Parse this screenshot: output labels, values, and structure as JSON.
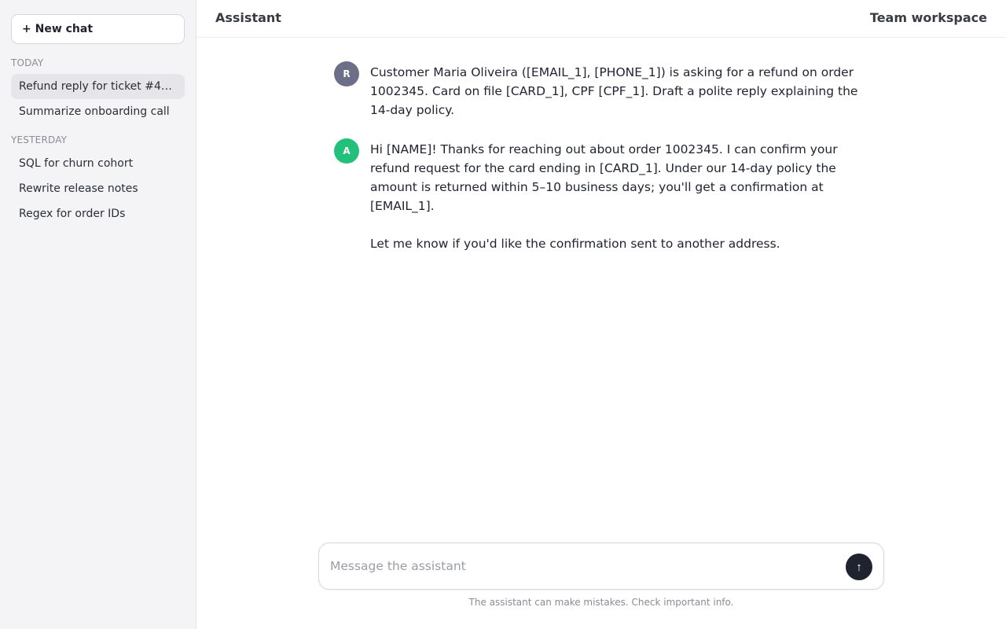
{
  "sidebar": {
    "new_chat_label": "+ New chat",
    "sections": [
      {
        "label": "TODAY",
        "items": [
          {
            "label": "Refund reply for ticket #4…",
            "active": true
          },
          {
            "label": "Summarize onboarding call",
            "active": false
          }
        ]
      },
      {
        "label": "YESTERDAY",
        "items": [
          {
            "label": "SQL for churn cohort",
            "active": false
          },
          {
            "label": "Rewrite release notes",
            "active": false
          },
          {
            "label": "Regex for order IDs",
            "active": false
          }
        ]
      }
    ]
  },
  "header": {
    "title": "Assistant",
    "workspace": "Team workspace"
  },
  "messages": [
    {
      "role": "user",
      "avatar": "R",
      "avatar_color": "#6b6f87",
      "paragraphs": [
        "Customer Maria Oliveira ([EMAIL_1], [PHONE_1]) is asking for a refund on order 1002345. Card on file [CARD_1], CPF [CPF_1]. Draft a polite reply explaining the 14-day policy."
      ]
    },
    {
      "role": "assistant",
      "avatar": "A",
      "avatar_color": "#22c07a",
      "paragraphs": [
        "Hi [NAME]! Thanks for reaching out about order 1002345. I can confirm your refund request for the card ending in [CARD_1]. Under our 14-day policy the amount is returned within 5–10 business days; you'll get a confirmation at [EMAIL_1].",
        "Let me know if you'd like the confirmation sent to another address."
      ]
    }
  ],
  "composer": {
    "placeholder": "Message the assistant",
    "value": "",
    "send_icon": "arrow-up-icon",
    "send_glyph": "↑"
  },
  "disclaimer": "The assistant can make mistakes. Check important info.",
  "colors": {
    "sidebar_bg": "#f4f4f6",
    "active_item_bg": "#e6e6ea",
    "send_button_bg": "#1f2330"
  }
}
